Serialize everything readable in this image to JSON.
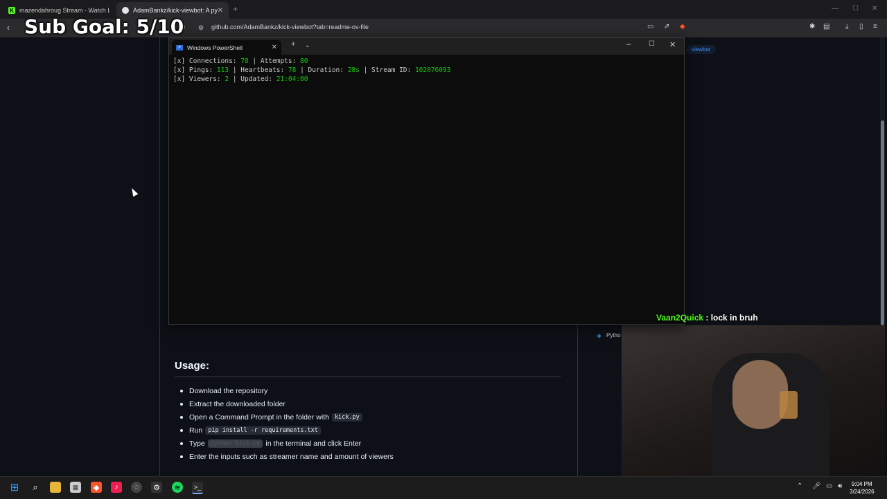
{
  "browser": {
    "tabs": [
      {
        "label": "mazendahroug Stream - Watch Live",
        "icon": "kick-icon"
      },
      {
        "label": "AdamBankz/kick-viewbot: A pyth",
        "icon": "github-icon"
      }
    ],
    "url": "github.com/AdamBankz/kick-viewbot?tab=readme-ov-file"
  },
  "overlay": {
    "sub_goal": "Sub Goal: 5/10",
    "chat_user": "Vaan2Quick",
    "chat_message": " : lock in bruh"
  },
  "github": {
    "topic_tag": "viewbot",
    "language": "Pytho",
    "usage_heading": "Usage:",
    "steps": {
      "s1": "Download the repository",
      "s2": "Extract the downloaded folder",
      "s3_pre": "Open a Command Prompt in the folder with",
      "s3_code": "kick.py",
      "s4_pre": "Run",
      "s4_code": "pip install -r requirements.txt",
      "s5_pre": "Type",
      "s5_code": "python kick.py",
      "s5_post": "in the terminal and click Enter",
      "s6": "Enter the inputs such as streamer name and amount of viewers"
    }
  },
  "powershell": {
    "tab_title": "Windows PowerShell",
    "line1": {
      "a": "[x] Connections: ",
      "v1": "78",
      "b": " | Attempts: ",
      "v2": "80"
    },
    "line2": {
      "a": "[x] Pings: ",
      "v1": "113",
      "b": " | Heartbeats: ",
      "v2": "78",
      "c": " | Duration: ",
      "v3": "28s",
      "d": " | Stream ID: ",
      "v4": "102076093"
    },
    "line3": {
      "a": "[x] Viewers: ",
      "v1": "2",
      "b": " | Updated: ",
      "v2": "21:04:00"
    }
  },
  "taskbar": {
    "time": "9:04 PM",
    "date": "3/24/2026"
  },
  "colors": {
    "accent_green": "#16c60c",
    "kick_green": "#53fc18",
    "link_blue": "#4493f8"
  }
}
